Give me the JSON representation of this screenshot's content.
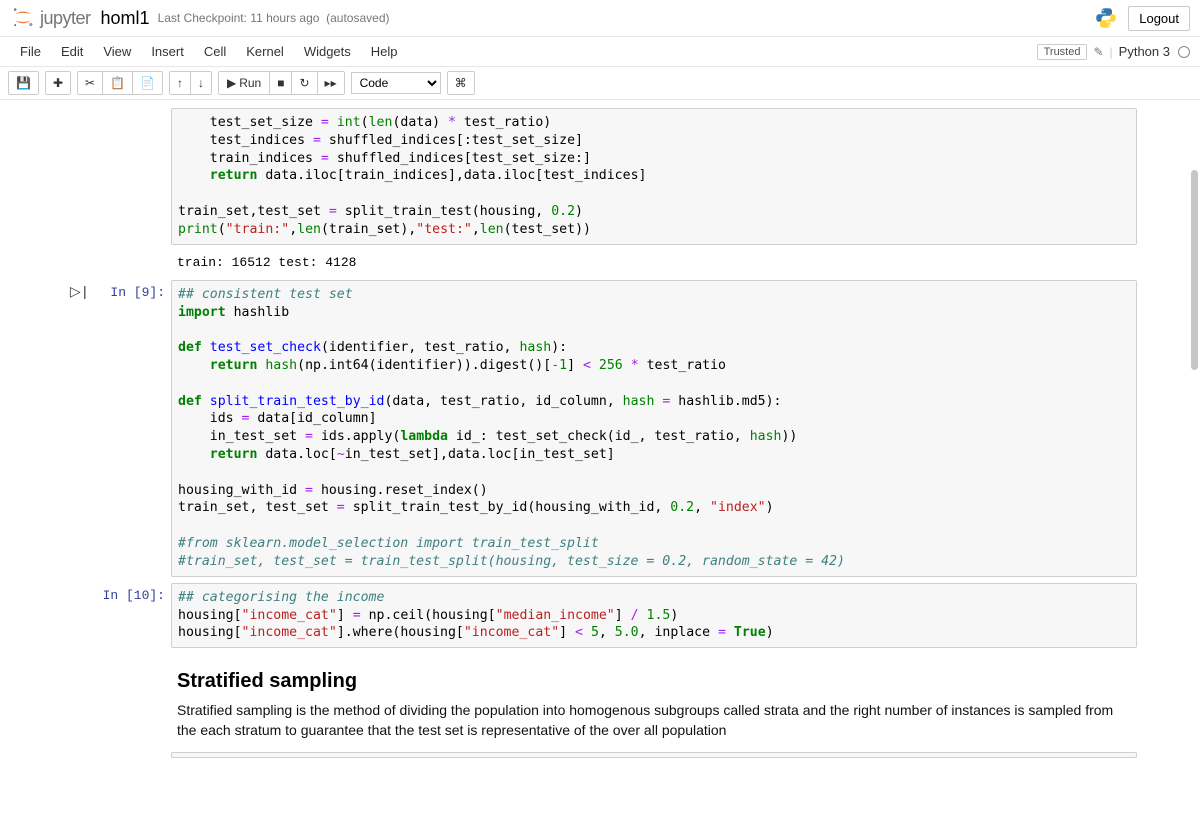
{
  "header": {
    "logo_text": "jupyter",
    "notebook_name": "homl1",
    "checkpoint": "Last Checkpoint: 11 hours ago",
    "autosave": "(autosaved)",
    "logout": "Logout"
  },
  "menubar": {
    "items": [
      "File",
      "Edit",
      "View",
      "Insert",
      "Cell",
      "Kernel",
      "Widgets",
      "Help"
    ],
    "trusted": "Trusted",
    "kernel": "Python 3"
  },
  "toolbar": {
    "run_label": "Run",
    "cell_type": "Code"
  },
  "cells": {
    "c8_output": "train: 16512 test: 4128",
    "prompt9": "In [9]:",
    "prompt10": "In [10]:"
  },
  "markdown": {
    "heading": "Stratified sampling",
    "body": "Stratified sampling is the method of dividing the population into homogenous subgroups called strata and the right number of instances is sampled from the each stratum to guarantee that the test set is representative of the over all population"
  },
  "code": {
    "cell8_tail": "    test_set_size = int(len(data) * test_ratio)\n    test_indices = shuffled_indices[:test_set_size]\n    train_indices = shuffled_indices[test_set_size:]\n    return data.iloc[train_indices],data.iloc[test_indices]\n\ntrain_set,test_set = split_train_test(housing, 0.2)\nprint(\"train:\",len(train_set),\"test:\",len(test_set))",
    "cell9": "## consistent test set\nimport hashlib\n\ndef test_set_check(identifier, test_ratio, hash):\n    return hash(np.int64(identifier)).digest()[-1] < 256 * test_ratio\n\ndef split_train_test_by_id(data, test_ratio, id_column, hash = hashlib.md5):\n    ids = data[id_column]\n    in_test_set = ids.apply(lambda id_: test_set_check(id_, test_ratio, hash))\n    return data.loc[~in_test_set],data.loc[in_test_set]\n\nhousing_with_id = housing.reset_index()\ntrain_set, test_set = split_train_test_by_id(housing_with_id, 0.2, \"index\")\n\n#from sklearn.model_selection import train_test_split\n#train_set, test_set = train_test_split(housing, test_size = 0.2, random_state = 42)",
    "cell10": "## categorising the income\nhousing[\"income_cat\"] = np.ceil(housing[\"median_income\"] / 1.5)\nhousing[\"income_cat\"].where(housing[\"income_cat\"] < 5, 5.0, inplace = True)"
  }
}
